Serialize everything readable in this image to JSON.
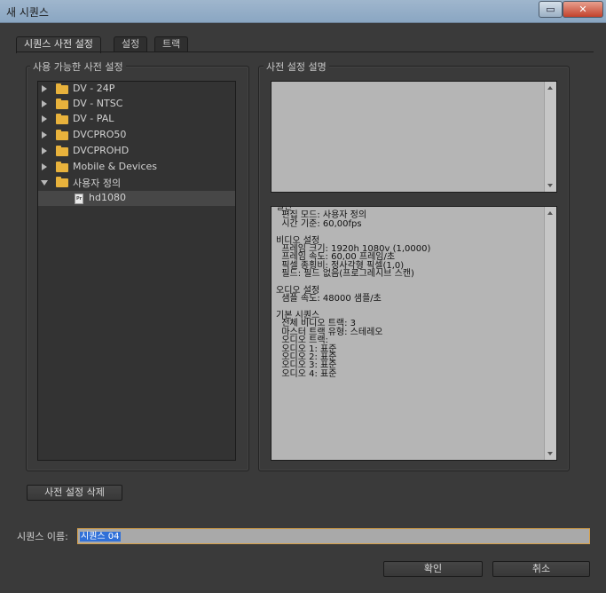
{
  "window": {
    "title": "새 시퀀스"
  },
  "tabs": [
    {
      "label": "시퀀스 사전 설정",
      "active": true
    },
    {
      "label": "설정",
      "active": false
    },
    {
      "label": "트랙",
      "active": false
    }
  ],
  "presets_panel": {
    "title": "사용 가능한 사전 설정",
    "items": [
      {
        "label": "DV - 24P",
        "type": "folder",
        "expanded": false
      },
      {
        "label": "DV - NTSC",
        "type": "folder",
        "expanded": false
      },
      {
        "label": "DV - PAL",
        "type": "folder",
        "expanded": false
      },
      {
        "label": "DVCPRO50",
        "type": "folder",
        "expanded": false
      },
      {
        "label": "DVCPROHD",
        "type": "folder",
        "expanded": false
      },
      {
        "label": "Mobile & Devices",
        "type": "folder",
        "expanded": false
      },
      {
        "label": "사용자 정의",
        "type": "folder",
        "expanded": true
      },
      {
        "label": "hd1080",
        "type": "preset-file",
        "selected": true,
        "icon_text": "Pr"
      }
    ]
  },
  "description_panel": {
    "title": "사전 설정 설명",
    "info_lines": [
      "일반",
      "  편집 모드: 사용자 정의",
      "  시간 기준: 60,00fps",
      "",
      "비디오 설정",
      "  프레임 크기: 1920h 1080v (1,0000)",
      "  프레임 속도: 60,00 프레임/초",
      "  픽셀 종횡비: 정사각형 픽셀(1,0)",
      "  필드: 필드 없음(프로그레시브 스캔)",
      "",
      "오디오 설정",
      "  샘플 속도: 48000 샘플/초",
      "",
      "기본 시퀀스",
      "  전체 비디오 트랙: 3",
      "  마스터 트랙 유형: 스테레오",
      "  오디오 트랙:",
      "  오디오 1: 표준",
      "  오디오 2: 표준",
      "  오디오 3: 표준",
      "  오디오 4: 표준"
    ]
  },
  "buttons": {
    "delete_preset": "사전 설정 삭제",
    "ok": "확인",
    "cancel": "취소"
  },
  "sequence_name": {
    "label": "시퀀스 이름:",
    "value": "시퀀스 04"
  },
  "colors": {
    "background": "#3a3a3a",
    "folder": "#e8b23c",
    "selection": "#3070d8",
    "input_focus_border": "#d6a04a"
  }
}
